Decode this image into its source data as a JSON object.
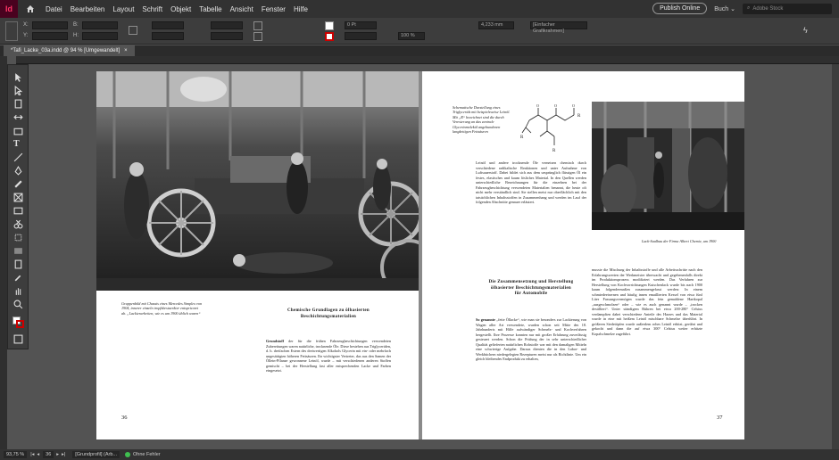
{
  "app": {
    "logo": "Id"
  },
  "menu": [
    "Datei",
    "Bearbeiten",
    "Layout",
    "Schrift",
    "Objekt",
    "Tabelle",
    "Ansicht",
    "Fenster",
    "Hilfe"
  ],
  "top_right": {
    "publish": "Publish Online",
    "workspace": "Buch",
    "search_placeholder": "Adobe Stock"
  },
  "control": {
    "x_label": "X:",
    "y_label": "Y:",
    "w_label": "B:",
    "h_label": "H:",
    "stroke_weight": "0 Pt",
    "scale_x": "100 %",
    "scale_y": "100 %",
    "ref_value": "4,233 mm",
    "opacity": "100 %",
    "frame_style": "[Einfacher Grafikrahmen]"
  },
  "doc_tab": {
    "title": "*Tafi_Lacke_03a.indd @ 94 % [Umgewandelt]",
    "close": "×"
  },
  "left_page": {
    "caption": "Gruppenbild mit Chassis eines Mercedes Simplex von 1904, innerer einzeln tropfsbestaerkter entspricoret ab. „Lackierarbeiten, wie es um 1900 üblich waren“",
    "heading_line1": "Chemische Grundlagen zu ölbasierten",
    "heading_line2": "Beschichtungsmaterialien",
    "body_lead": "Grundstoff",
    "body": "der für die frühen Fahrzeugbeschichtungen verwendeten Zubereitungen waren natürliche, trocknende Öle. Diese bestehen aus Triglyceriden, d. h. dreifachen Estern des dreiwertigen Alkohols Glycerin mit ein- oder mehrfach ungesättigten höheren Fettsäuren. Ihr wichtigster Vertreter, das aus den Samen der Öllein-Pflanze gewonnene Leinöl, wurde – mit verschiedenen anderen Stoffen gemischt – bei der Herstellung fast aller entsprechenden Lacke und Farben eingesetzt.",
    "page_number": "36"
  },
  "right_page": {
    "formula_caption": "Schematische Darstellung eines Triglycerids mit beispielsweise Leinöl. Mit „R“ bezeichnet sind die durch Veresterung an das zentrale Glycerinmolekül angebundenen langkettigen Fettsäuren",
    "photo_caption": "Lack-Saalbau der Firma Albert Chemie, um 1900",
    "col1_body": "Leinöl und andere trocknende Öle vernetzen chemisch durch verschiedene radikalische Reaktionen und unter Aufnahme von Luftsauerstoff. Dabei bildet sich aus dem ursprünglich flüssigen Öl ein festes, elastisches und kaum lösliches Material. In den Quellen werden unterschiedliche Bezeichnungen für die einzelnen bei der Fahrzeugbeschichtung verwendeten Materialien benannt, die heute oft nicht mehr verständlich sind. Sie stellen meist nur oberflächlich mit den tatsächlichen Inhaltsstoffen in Zusammenhang und werden im Lauf der folgenden Abschnitte genauer erläutert.",
    "heading_line1": "Die Zusammensetzung und Herstellung",
    "heading_line2": "ölbasierter Beschichtungsmaterialien",
    "heading_line3": "für Automobile",
    "col1_lower_lead": "So genannte",
    "col1_lower": "„fette Öllacke“, wie man sie besonders zur Lackierung von Wagen aller Art verwendete, wurden schon seit Mitte des 18. Jahrhunderts mit Hilfe aufwändiger Schmelz- und Kochverfahren hergestellt. Ihre Prozesse konnten nur mit großer Erfahrung zuverlässig gesteuert werden. Schon die Prüfung der in sehr unterschiedlicher Qualität gelieferten natürlichen Rohstoffe war mit den damaligen Mitteln eine schwierige Aufgabe. Daraus dienten die in den Labor- und Werkbüchern niedergelegten Rezepturen meist nur als Richtlinie. Um ein gleich bleibendes Endprodukt zu erhalten,",
    "col2_body": "musste die Mischung der Inhaltsstoffe und alle Arbeitsschritte nach den Erfahrungswerten der Werkmeister überwacht und gegebenenfalls direkt im Produktionsprozess modifiziert werden. Das Verfahren zur Herstellung von Kochvorrichtungen Kutschenlack wurde bis nach 1900 kaum folgendermaßen zusammengefasst werden: In einem schmiedeeisernen und häufig innen emaillierten Kessel von etwa fünf Liter Fassungsvermögen wurde das fein gemahlene Hartkopal „ausgeschmolzen“ oder – wie es auch genannt wurde – „trocken destilliert“. Unter ständigem Rühren bei etwa 200-280° Celsius verdampften dabei verschiedene Anteile des Harzes und das Material wurde in eine mit heißem Leinöl mischbare Schmelze überführt. In größeren Siedetöpfen wurde außerdem rohes Leinöl erhitzt, gerührt und gekocht und dann die auf etwa 300° Celsius weiter erhitzte Kopalschmelze zugeführt.",
    "page_number": "37"
  },
  "status": {
    "zoom": "93,75 %",
    "page": "36",
    "profile": "[Grundprofil] (Arb...",
    "errors": "Ohne Fehler"
  },
  "colors": {
    "accent": "#ff3366",
    "ok": "#3fbf50"
  }
}
